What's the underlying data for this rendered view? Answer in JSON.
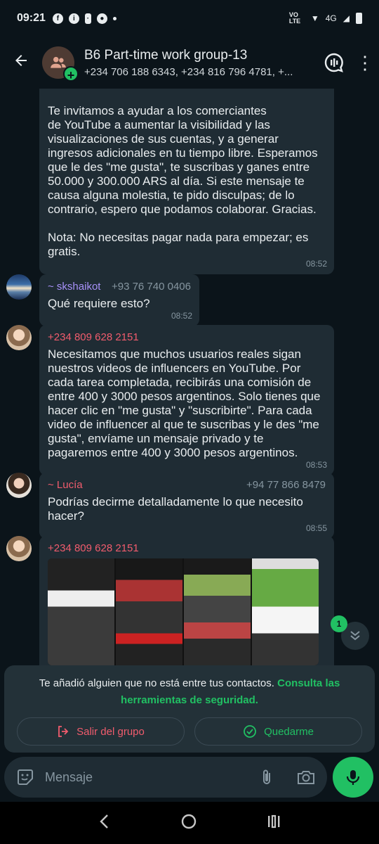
{
  "status": {
    "time": "09:21",
    "network": "4G",
    "volte": "VO LTE"
  },
  "header": {
    "title": "B6 Part-time work group-13",
    "subtitle": "+234 706 188 6343, +234 816 796 4781, +..."
  },
  "messages": [
    {
      "body": "Te invitamos a ayudar a los comerciantes\nde YouTube a aumentar la visibilidad y las visualizaciones de sus cuentas, y a generar ingresos adicionales en tu tiempo libre. Esperamos que le des \"me gusta\", te suscribas y ganes entre 50.000 y 300.000 ARS al día. Si este mensaje te causa alguna molestia, te pido disculpas; de lo contrario, espero que podamos colaborar. Gracias.\n\nNota: No necesitas pagar nada para empezar; es gratis.",
      "time": "08:52"
    },
    {
      "sender": "~ skshaikot",
      "sender_color": "#a791f8",
      "phone": "+93 76 740 0406",
      "body": "Qué requiere esto?",
      "time": "08:52"
    },
    {
      "sender": "+234 809 628 2151",
      "sender_color": "#f15c6d",
      "body": "Necesitamos que muchos usuarios reales sigan nuestros videos de influencers en YouTube. Por cada tarea completada, recibirás una comisión de entre 400 y 3000 pesos argentinos. Solo tienes que hacer clic en \"me gusta\" y \"suscribirte\". Para cada video de influencer al que te suscribas y le des \"me gusta\", envíame un mensaje privado y te pagaremos entre 400 y 3000 pesos argentinos.",
      "time": "08:53"
    },
    {
      "sender": "~ Lucía",
      "sender_color": "#f15c6d",
      "phone": "+94 77 866 8479",
      "body": "Podrías decirme detalladamente lo que necesito hacer?",
      "time": "08:55"
    },
    {
      "sender": "+234 809 628 2151",
      "sender_color": "#f15c6d"
    }
  ],
  "unread_count": "1",
  "notice": {
    "text": "Te añadió alguien que no está entre tus contactos. ",
    "link": "Consulta las herramientas de seguridad.",
    "leave_label": "Salir del grupo",
    "stay_label": "Quedarme"
  },
  "composer": {
    "placeholder": "Mensaje"
  },
  "colors": {
    "accent": "#21c063",
    "danger": "#f15c6d",
    "bubble": "#1f2c34",
    "background": "#0b141a"
  }
}
